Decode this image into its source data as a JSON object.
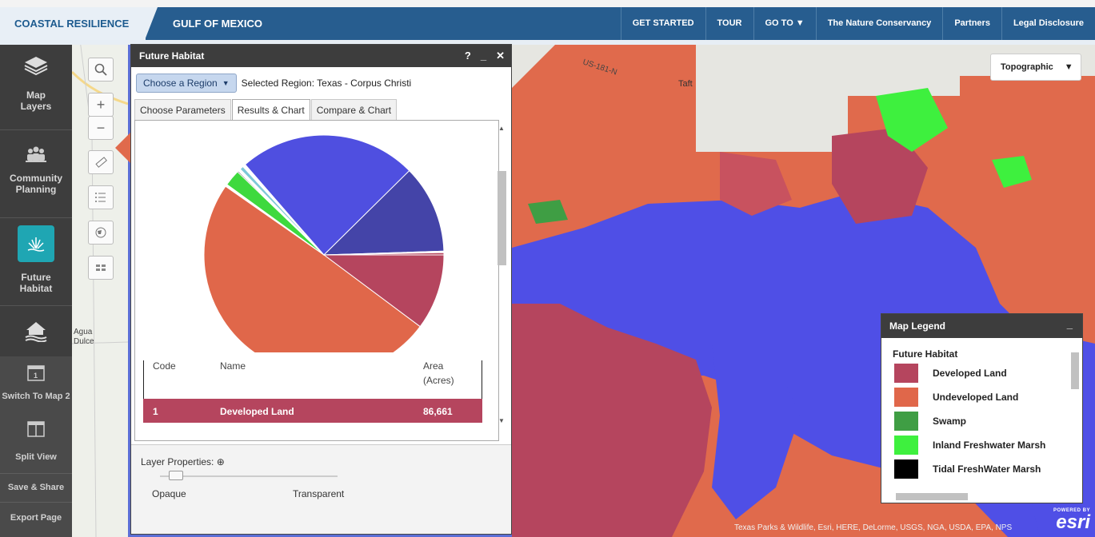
{
  "header": {
    "brand": "COASTAL RESILIENCE",
    "region": "GULF OF MEXICO",
    "nav": [
      "GET STARTED",
      "TOUR",
      "GO TO ▼",
      "The Nature Conservancy",
      "Partners",
      "Legal Disclosure"
    ]
  },
  "sidebar": {
    "items": [
      {
        "label1": "Map",
        "label2": "Layers",
        "icon": "layers-icon"
      },
      {
        "label1": "Community",
        "label2": "Planning",
        "icon": "people-icon"
      },
      {
        "label1": "Future",
        "label2": "Habitat",
        "icon": "marsh-icon"
      },
      {
        "label1": "",
        "label2": "",
        "icon": "house-flood-icon"
      }
    ],
    "lower": [
      "Switch To Map 2",
      "Split View",
      "Save & Share",
      "Export Page"
    ]
  },
  "map": {
    "basemap_label": "Topographic",
    "place_labels": [
      "Taft",
      "Agua",
      "Dulce"
    ],
    "road_labels": [
      "US-181-N"
    ],
    "attribution": "Texas Parks & Wildlife, Esri, HERE, DeLorme, USGS, NGA, USDA, EPA, NPS",
    "esri_powered": "POWERED BY",
    "esri_logo": "esri"
  },
  "panel": {
    "title": "Future Habitat",
    "help": "?",
    "minimize": "_",
    "close": "✕",
    "region_button": "Choose a Region",
    "selected_region": "Selected Region: Texas - Corpus Christi",
    "tabs": [
      {
        "label": "Choose Parameters",
        "active": false
      },
      {
        "label": "Results & Chart",
        "active": true
      },
      {
        "label": "Compare & Chart",
        "active": false
      }
    ],
    "table": {
      "headers": [
        "Code",
        "Name",
        "Area",
        "(Acres)"
      ],
      "rows": [
        {
          "code": "1",
          "name": "Developed Land",
          "area": "86,661",
          "color": "#b5455e"
        }
      ]
    },
    "layer_properties": "Layer Properties:",
    "opaque": "Opaque",
    "transparent": "Transparent",
    "opacity_value": 0.05
  },
  "chart_data": {
    "type": "pie",
    "slices": [
      {
        "color": "#b5455e",
        "value": 10.2
      },
      {
        "color": "#e0674a",
        "value": 49.5
      },
      {
        "color": "#ffffff",
        "value": 0.3
      },
      {
        "color": "#3ed93e",
        "value": 2.2
      },
      {
        "color": "#2c2c2c",
        "value": 0.15
      },
      {
        "color": "#ffffff",
        "value": 0.35
      },
      {
        "color": "#7ec8d8",
        "value": 0.5
      },
      {
        "color": "#ffffff",
        "value": 0.4
      },
      {
        "color": "#4f4fe0",
        "value": 24.0
      },
      {
        "color": "#4444a8",
        "value": 11.9
      },
      {
        "color": "#ffffff",
        "value": 0.2
      },
      {
        "color": "#b5455e",
        "value": 0.3
      }
    ]
  },
  "legend": {
    "title": "Map Legend",
    "minimize": "_",
    "section": "Future Habitat",
    "items": [
      {
        "label": "Developed Land",
        "color": "#b5455e"
      },
      {
        "label": "Undeveloped Land",
        "color": "#e0674a"
      },
      {
        "label": "Swamp",
        "color": "#3f9e44"
      },
      {
        "label": "Inland Freshwater Marsh",
        "color": "#3ef03e"
      },
      {
        "label": "Tidal FreshWater Marsh",
        "color": "#000000"
      }
    ]
  }
}
